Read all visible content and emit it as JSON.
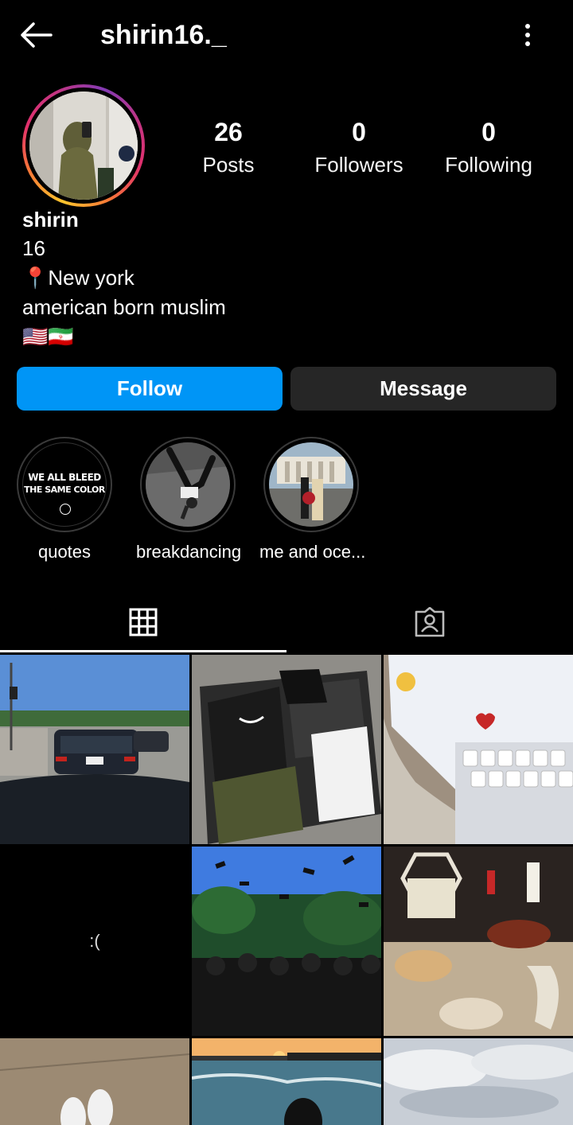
{
  "header": {
    "username": "shirin16._",
    "back_icon": "arrow-left-icon",
    "more_icon": "vertical-dots-icon"
  },
  "stats": [
    {
      "value": "26",
      "label": "Posts"
    },
    {
      "value": "0",
      "label": "Followers"
    },
    {
      "value": "0",
      "label": "Following"
    }
  ],
  "bio": {
    "name": "shirin",
    "lines": [
      "16",
      "📍New york",
      "american born muslim",
      "🇺🇸🇮🇷"
    ]
  },
  "buttons": {
    "follow": "Follow",
    "message": "Message"
  },
  "highlights": [
    {
      "label": "quotes",
      "cover_text": [
        "WE ALL BLEED",
        "THE SAME COLOR"
      ]
    },
    {
      "label": "breakdancing"
    },
    {
      "label": "me and oce..."
    }
  ],
  "tabs": [
    {
      "name": "posts-grid",
      "icon": "grid-icon",
      "active": true
    },
    {
      "name": "tagged",
      "icon": "tagged-person-icon",
      "active": false
    }
  ],
  "grid_posts": [
    {
      "kind": "photo",
      "subject": "car-windshield-road"
    },
    {
      "kind": "photo",
      "subject": "open-suitcase"
    },
    {
      "kind": "photo",
      "subject": "phone-keyboard-heart"
    },
    {
      "kind": "text",
      "text": ":("
    },
    {
      "kind": "photo",
      "subject": "graduation-caps"
    },
    {
      "kind": "photo",
      "subject": "ramadan-table"
    },
    {
      "kind": "photo",
      "subject": "shoes-floor"
    },
    {
      "kind": "photo",
      "subject": "ocean-sunset"
    },
    {
      "kind": "photo",
      "subject": "cloudy-sky"
    }
  ],
  "colors": {
    "follow_button": "#0095f6",
    "message_button": "#262626",
    "background": "#000000"
  }
}
